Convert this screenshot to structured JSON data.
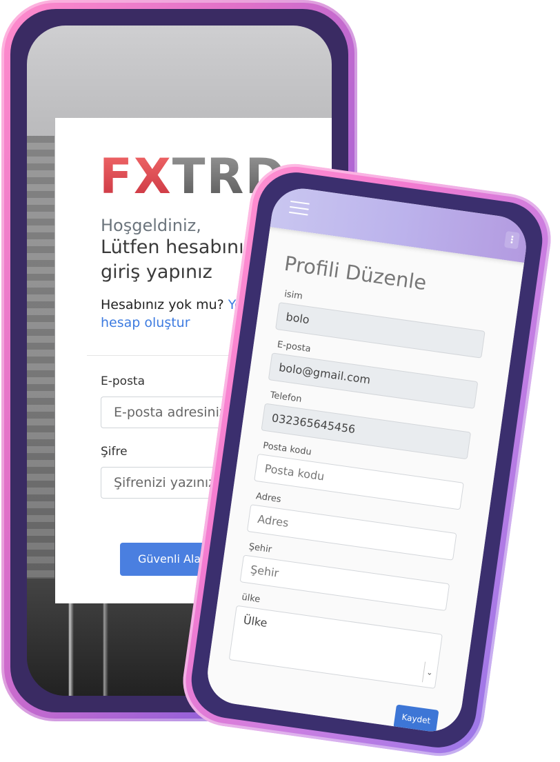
{
  "login": {
    "logo_part1": "FX",
    "logo_part2": "TRD",
    "welcome": "Hoşgeldiniz,",
    "subtitle": "Lütfen hesabınıza giriş yapınız",
    "no_account": "Hesabınız yok mu?",
    "create_account_link": "Yeni hesap oluştur",
    "email_label": "E-posta",
    "email_placeholder": "E-posta adresinizi yazınız",
    "password_label": "Şifre",
    "password_placeholder": "Şifrenizi yazınız",
    "login_button": "Güvenli Alana Giriş"
  },
  "profile": {
    "title": "Profili Düzenle",
    "fields": {
      "name_label": "isim",
      "name_value": "bolo",
      "email_label": "E-posta",
      "email_value": "bolo@gmail.com",
      "phone_label": "Telefon",
      "phone_value": "032365645456",
      "postal_label": "Posta kodu",
      "postal_placeholder": "Posta kodu",
      "address_label": "Adres",
      "address_placeholder": "Adres",
      "city_label": "Şehir",
      "city_placeholder": "Şehir",
      "country_label": "ülke",
      "country_selected": "Ülke"
    },
    "save_button": "Kaydet"
  },
  "icons": {
    "menu": "hamburger-icon",
    "more": "kebab-icon",
    "dropdown": "chevron-down-icon"
  },
  "colors": {
    "accent_blue": "#4a7fe0",
    "logo_red": "#e0515a",
    "phone_frame_pink": "#f37bd0",
    "phone_bezel": "#3b2f6e"
  }
}
